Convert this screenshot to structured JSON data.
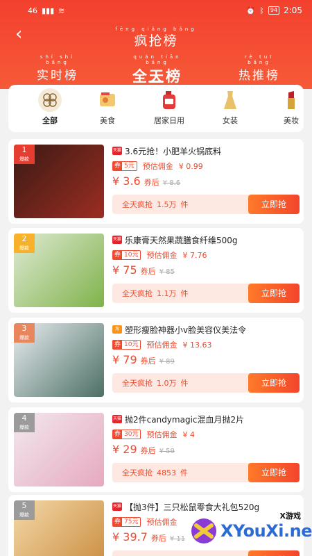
{
  "status": {
    "time": "2:05",
    "battery": "94",
    "left": "46"
  },
  "header": {
    "title": "疯抢榜",
    "title_pinyin": "fēng qiǎng bǎng",
    "tabs": [
      {
        "label": "实时榜",
        "pinyin": "shí shí bǎng"
      },
      {
        "label": "全天榜",
        "pinyin": "quán tiān bǎng"
      },
      {
        "label": "热推榜",
        "pinyin": "rè tuī bǎng"
      }
    ]
  },
  "categories": [
    {
      "label": "全部",
      "icon": "all-icon"
    },
    {
      "label": "美食",
      "icon": "food-icon"
    },
    {
      "label": "居家日用",
      "icon": "household-icon"
    },
    {
      "label": "女装",
      "icon": "dress-icon"
    },
    {
      "label": "美妆",
      "icon": "lipstick-icon"
    }
  ],
  "labels": {
    "coupon_q": "券",
    "est_commission": "预估佣金",
    "after_coupon": "券后",
    "sold_prefix": "全天疯抢",
    "sold_suffix": "件",
    "buy": "立即抢",
    "hot": "爆款"
  },
  "products": [
    {
      "rank": "1",
      "platform": "天猫",
      "title": "3.6元抢！小肥羊火锅底料",
      "coupon": "5元",
      "commission": "¥ 0.99",
      "price": "¥ 3.6",
      "orig": "¥ 8.6",
      "sold": "1.5万",
      "rank_color": "#e53d2f"
    },
    {
      "rank": "2",
      "platform": "天猫",
      "title": "乐康膏天然果蔬膳食纤维500g",
      "coupon": "10元",
      "commission": "¥ 7.76",
      "price": "¥ 75",
      "orig": "¥ 85",
      "sold": "1.1万",
      "rank_color": "#f7b12b"
    },
    {
      "rank": "3",
      "platform": "淘",
      "title": "塑形瘦脸神器小v脸美容仪美法令",
      "coupon": "10元",
      "commission": "¥ 13.63",
      "price": "¥ 79",
      "orig": "¥ 89",
      "sold": "1.0万",
      "rank_color": "#e8865e"
    },
    {
      "rank": "4",
      "platform": "天猫",
      "title": "抛2件candymagic混血月抛2片",
      "coupon": "30元",
      "commission": "¥ 4",
      "price": "¥ 29",
      "orig": "¥ 59",
      "sold": "4853",
      "rank_color": "#9b9b9b"
    },
    {
      "rank": "5",
      "platform": "天猫",
      "title": "【抛3件】三只松鼠零食大礼包520g",
      "coupon": "75元",
      "commission": "",
      "price": "¥ 39.7",
      "orig": "¥ 11",
      "sold": "",
      "rank_color": "#9b9b9b"
    }
  ],
  "watermark": {
    "text": "XYouXi.net",
    "sub": "X游戏"
  }
}
